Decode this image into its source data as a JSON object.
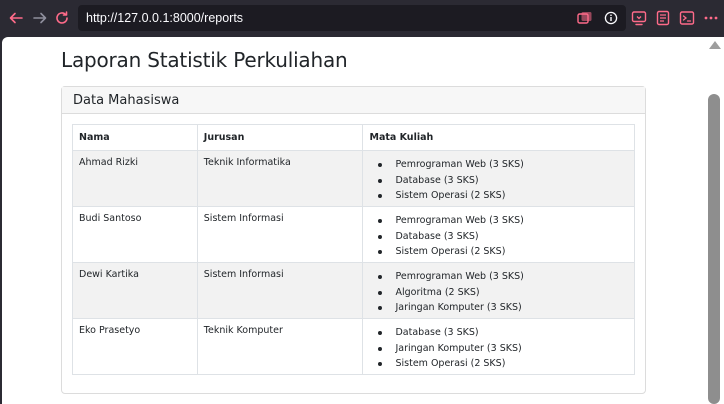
{
  "browser": {
    "url": "http://127.0.0.1:8000/reports"
  },
  "page": {
    "title": "Laporan Statistik Perkuliahan",
    "card_title": "Data Mahasiswa"
  },
  "table": {
    "headers": [
      "Nama",
      "Jurusan",
      "Mata Kuliah"
    ],
    "rows": [
      {
        "nama": "Ahmad Rizki",
        "jurusan": "Teknik Informatika",
        "mata_kuliah": [
          "Pemrograman Web (3 SKS)",
          "Database (3 SKS)",
          "Sistem Operasi (2 SKS)"
        ]
      },
      {
        "nama": "Budi Santoso",
        "jurusan": "Sistem Informasi",
        "mata_kuliah": [
          "Pemrograman Web (3 SKS)",
          "Database (3 SKS)",
          "Sistem Operasi (2 SKS)"
        ]
      },
      {
        "nama": "Dewi Kartika",
        "jurusan": "Sistem Informasi",
        "mata_kuliah": [
          "Pemrograman Web (3 SKS)",
          "Algoritma (2 SKS)",
          "Jaringan Komputer (3 SKS)"
        ]
      },
      {
        "nama": "Eko Prasetyo",
        "jurusan": "Teknik Komputer",
        "mata_kuliah": [
          "Database (3 SKS)",
          "Jaringan Komputer (3 SKS)",
          "Sistem Operasi (2 SKS)"
        ]
      }
    ]
  },
  "icons": {
    "back": "arrow-left-icon",
    "forward": "arrow-right-icon",
    "reload": "reload-icon",
    "tab_switch": "tabs-icon",
    "site_info": "info-icon",
    "screenshot": "screenshot-icon",
    "reader": "reader-view-icon",
    "terminal": "terminal-icon",
    "menu": "more-icon"
  },
  "colors": {
    "chrome_bg": "#2b2a33",
    "urlbar_bg": "#1c1b22",
    "accent_pink": "#ff6b8a",
    "row_stripe": "#f2f2f2"
  }
}
